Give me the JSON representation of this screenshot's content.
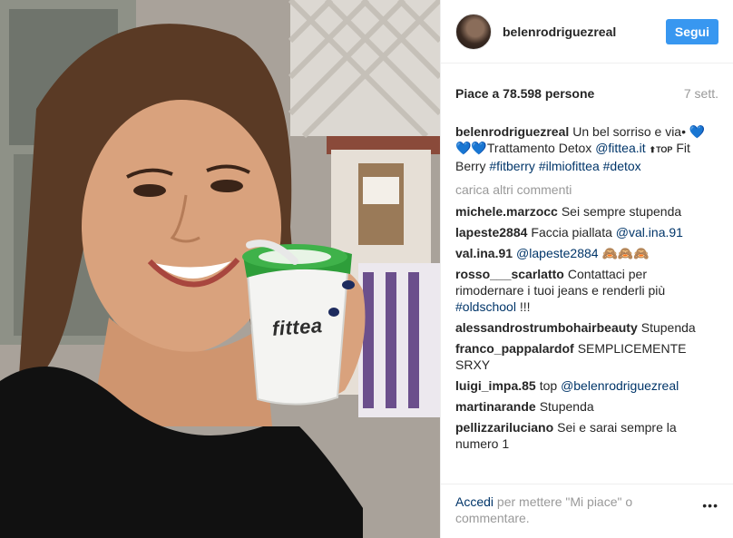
{
  "header": {
    "username": "belenrodriguezreal",
    "follow_label": "Segui"
  },
  "stats": {
    "likes": "Piace a 78.598 persone",
    "time_ago": "7 sett."
  },
  "photo": {
    "cup_logo": "fittea"
  },
  "caption": {
    "user": "belenrodriguezreal",
    "text_1": "Un bel sorriso e via•",
    "hearts": "💙💙💙",
    "text_2": "Trattamento Detox",
    "tag_1": "@fittea.it",
    "top_icon": "⬆TOP",
    "text_3": "Fit Berry",
    "tag_2": "#fitberry",
    "tag_3": "#ilmiofittea",
    "tag_4": "#detox"
  },
  "load_more": "carica altri commenti",
  "comments": [
    {
      "user": "michele.marzocc",
      "text": "Sei sempre stupenda"
    },
    {
      "user": "lapeste2884",
      "text": "Faccia piallata",
      "tag": "@val.ina.91"
    },
    {
      "user": "val.ina.91",
      "tag": "@lapeste2884",
      "text": "🙈🙈🙈"
    },
    {
      "user": "rosso___scarlatto",
      "text": "Contattaci per rimodernare i tuoi jeans e renderli più",
      "tag": "#oldschool",
      "text_after": "!!!"
    },
    {
      "user": "alessandrostrumbohairbeauty",
      "text": "Stupenda"
    },
    {
      "user": "franco_pappalardof",
      "text": "SEMPLICEMENTE SRXY"
    },
    {
      "user": "luigi_impa.85",
      "text": "top",
      "tag": "@belenrodriguezreal"
    },
    {
      "user": "martinarande",
      "text": "Stupenda"
    },
    {
      "user": "pellizzariluciano",
      "text": "Sei e sarai sempre la numero 1"
    }
  ],
  "footer": {
    "login_label": "Accedi",
    "text": "per mettere \"Mi piace\" o commentare.",
    "more_icon": "•••"
  },
  "colors": {
    "accent": "#3897f0",
    "link": "#003569",
    "muted": "#999999",
    "text": "#262626",
    "cup_green": "#2e9e3a"
  }
}
